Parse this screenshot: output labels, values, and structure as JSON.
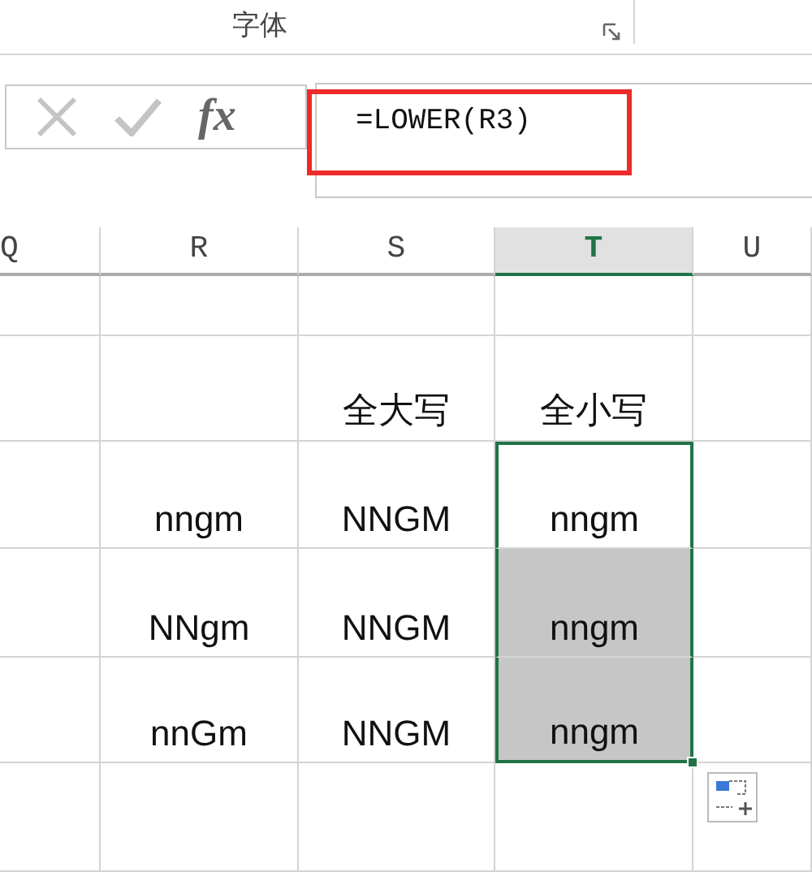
{
  "ribbon": {
    "group_label": "字体"
  },
  "formula_bar": {
    "fx_label": "fx",
    "formula": "=LOWER(R3)",
    "highlighted": true
  },
  "columns": [
    {
      "label": "Q",
      "selected": false
    },
    {
      "label": "R",
      "selected": false
    },
    {
      "label": "S",
      "selected": false
    },
    {
      "label": "T",
      "selected": true
    },
    {
      "label": "U",
      "selected": false
    }
  ],
  "rows": [
    {
      "cells": [
        {
          "selected": false,
          "active": false
        },
        {
          "selected": false,
          "active": false
        },
        {
          "selected": false,
          "active": false
        },
        {
          "selected": false,
          "active": false
        },
        {
          "selected": false,
          "active": false
        }
      ]
    },
    {
      "cells": [
        {
          "selected": false,
          "active": false
        },
        {
          "selected": false,
          "active": false
        },
        {
          "text": "全大写",
          "selected": false,
          "active": false
        },
        {
          "text": "全小写",
          "selected": false,
          "active": false
        },
        {
          "selected": false,
          "active": false
        }
      ]
    },
    {
      "cells": [
        {
          "selected": false,
          "active": false
        },
        {
          "text": "nngm",
          "selected": false,
          "active": false
        },
        {
          "text": "NNGM",
          "selected": false,
          "active": false
        },
        {
          "text": "nngm",
          "selected": true,
          "active": true
        },
        {
          "selected": false,
          "active": false
        }
      ]
    },
    {
      "cells": [
        {
          "selected": false,
          "active": false
        },
        {
          "text": "NNgm",
          "selected": false,
          "active": false
        },
        {
          "text": "NNGM",
          "selected": false,
          "active": false
        },
        {
          "text": "nngm",
          "selected": true,
          "active": false
        },
        {
          "selected": false,
          "active": false
        }
      ]
    },
    {
      "cells": [
        {
          "selected": false,
          "active": false
        },
        {
          "text": "nnGm",
          "selected": false,
          "active": false
        },
        {
          "text": "NNGM",
          "selected": false,
          "active": false
        },
        {
          "text": "nngm",
          "selected": true,
          "active": false
        },
        {
          "selected": false,
          "active": false
        }
      ]
    },
    {
      "cells": [
        {
          "selected": false,
          "active": false
        },
        {
          "selected": false,
          "active": false
        },
        {
          "selected": false,
          "active": false
        },
        {
          "selected": false,
          "active": false
        },
        {
          "selected": false,
          "active": false
        }
      ]
    }
  ]
}
